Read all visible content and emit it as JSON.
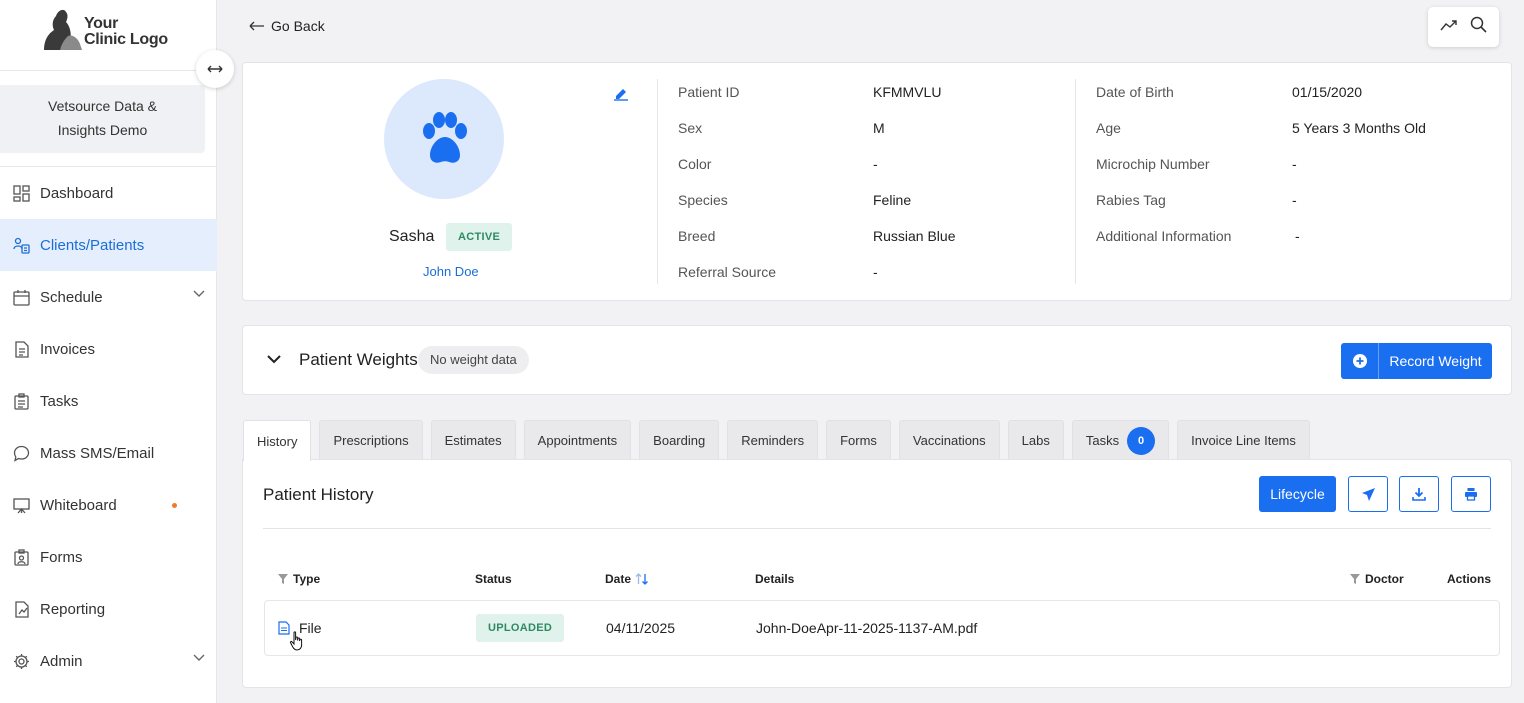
{
  "logo": {
    "line1": "Your",
    "line2": "Clinic Logo"
  },
  "clinic_name": "Vetsource Data & Insights Demo",
  "sidebar": {
    "items": [
      {
        "label": "Dashboard",
        "icon": "dashboard-icon"
      },
      {
        "label": "Clients/Patients",
        "icon": "clients-icon",
        "active": true
      },
      {
        "label": "Schedule",
        "icon": "calendar-icon",
        "expandable": true
      },
      {
        "label": "Invoices",
        "icon": "invoice-icon"
      },
      {
        "label": "Tasks",
        "icon": "clipboard-icon"
      },
      {
        "label": "Mass SMS/Email",
        "icon": "chat-icon"
      },
      {
        "label": "Whiteboard",
        "icon": "whiteboard-icon",
        "notification_dot": true
      },
      {
        "label": "Forms",
        "icon": "forms-icon"
      },
      {
        "label": "Reporting",
        "icon": "reporting-icon"
      },
      {
        "label": "Admin",
        "icon": "gear-icon",
        "expandable": true
      }
    ]
  },
  "header": {
    "go_back": "Go Back",
    "tools": [
      "trending-icon",
      "search-icon"
    ]
  },
  "patient": {
    "name": "Sasha",
    "status": "ACTIVE",
    "owner": "John Doe",
    "fields_left": [
      {
        "label": "Patient ID",
        "value": "KFMMVLU"
      },
      {
        "label": "Sex",
        "value": "M"
      },
      {
        "label": "Color",
        "value": "-"
      },
      {
        "label": "Species",
        "value": "Feline"
      },
      {
        "label": "Breed",
        "value": "Russian Blue"
      },
      {
        "label": "Referral Source",
        "value": "-"
      }
    ],
    "fields_right": [
      {
        "label": "Date of Birth",
        "value": "01/15/2020"
      },
      {
        "label": "Age",
        "value": "5 Years 3 Months Old"
      },
      {
        "label": "Microchip Number",
        "value": "-"
      },
      {
        "label": "Rabies Tag",
        "value": "-"
      },
      {
        "label": "Additional Information",
        "value": "-"
      }
    ]
  },
  "weights": {
    "title": "Patient Weights",
    "badge": "No weight data",
    "record_button": "Record Weight"
  },
  "tabs": [
    {
      "label": "History",
      "active": true
    },
    {
      "label": "Prescriptions"
    },
    {
      "label": "Estimates"
    },
    {
      "label": "Appointments"
    },
    {
      "label": "Boarding"
    },
    {
      "label": "Reminders"
    },
    {
      "label": "Forms"
    },
    {
      "label": "Vaccinations"
    },
    {
      "label": "Labs"
    },
    {
      "label": "Tasks",
      "count": "0"
    },
    {
      "label": "Invoice Line Items"
    }
  ],
  "history": {
    "title": "Patient History",
    "lifecycle_button": "Lifecycle",
    "columns": {
      "type": "Type",
      "status": "Status",
      "date": "Date",
      "details": "Details",
      "doctor": "Doctor",
      "actions": "Actions"
    },
    "rows": [
      {
        "type": "File",
        "status": "UPLOADED",
        "date": "04/11/2025",
        "details": "John-DoeApr-11-2025-1137-AM.pdf",
        "doctor": "",
        "actions": ""
      }
    ]
  },
  "colors": {
    "accent": "#1a6ef0",
    "active_nav_bg": "#e5eefc",
    "status_green_bg": "#dff3ec",
    "status_green_text": "#2f8a63"
  }
}
